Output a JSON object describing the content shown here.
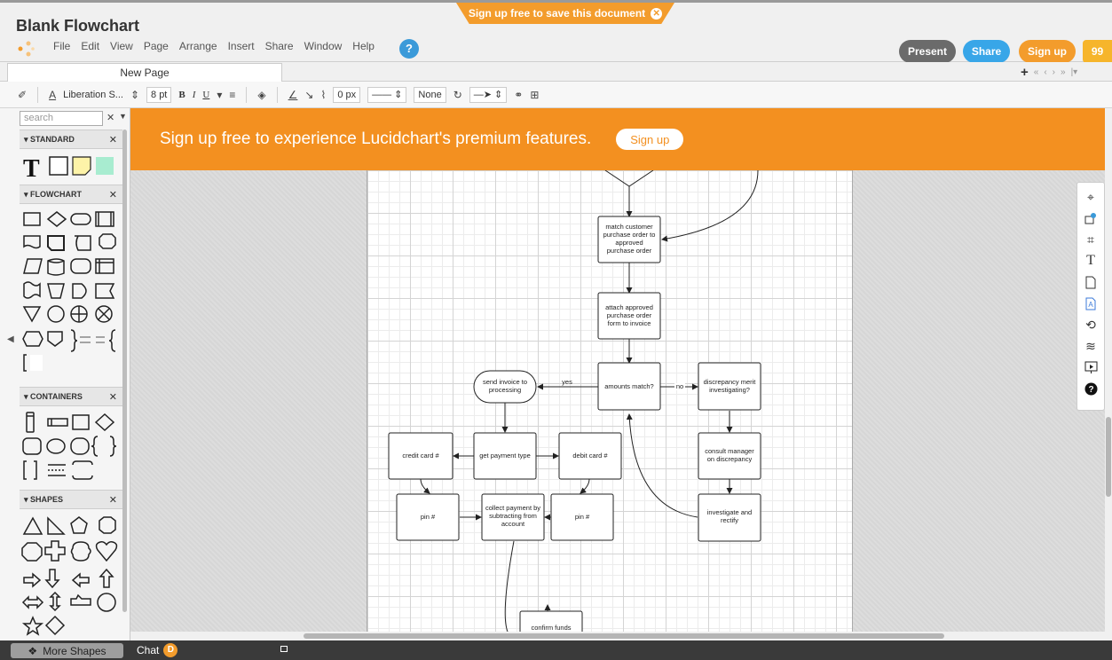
{
  "banner": {
    "signup_text": "Sign up free to save this document"
  },
  "document": {
    "title": "Blank Flowchart"
  },
  "menu": [
    "File",
    "Edit",
    "View",
    "Page",
    "Arrange",
    "Insert",
    "Share",
    "Window",
    "Help"
  ],
  "header_buttons": {
    "present": "Present",
    "share": "Share",
    "signup": "Sign up",
    "feedback": "99"
  },
  "tabs": {
    "page_tab": "New Page"
  },
  "toolbar": {
    "font": "Liberation S...",
    "font_size": "8 pt",
    "bold": "B",
    "italic": "I",
    "underline": "U",
    "line_width": "0 px",
    "end_style": "None"
  },
  "sidebar": {
    "search_placeholder": "search",
    "sections": [
      "STANDARD",
      "FLOWCHART",
      "CONTAINERS",
      "SHAPES"
    ]
  },
  "promo": {
    "text": "Sign up free to experience Lucidchart's premium features.",
    "button": "Sign up"
  },
  "flowchart": {
    "nodes": {
      "match": "match customer purchase order to approved purchase order",
      "attach": "attach approved purchase order form to invoice",
      "amounts": "amounts match?",
      "discrepancy": "discrepancy merit investigating?",
      "send": "send invoice to processing",
      "get_payment": "get payment type",
      "credit": "credit card #",
      "debit": "debit card #",
      "consult": "consult manager on discrepancy",
      "pin_left": "pin #",
      "collect": "collect payment by subtracting from account",
      "pin_right": "pin #",
      "investigate": "investigate and rectify",
      "confirm": "confirm funds"
    },
    "edge_labels": {
      "yes": "yes",
      "no": "no"
    }
  },
  "bottom": {
    "more_shapes": "More Shapes",
    "chat": "Chat",
    "chat_badge": "D"
  },
  "colors": {
    "orange": "#f39020",
    "share_blue": "#38a6e8",
    "present_gray": "#6b6b6b",
    "help_blue": "#3b9ad9"
  }
}
